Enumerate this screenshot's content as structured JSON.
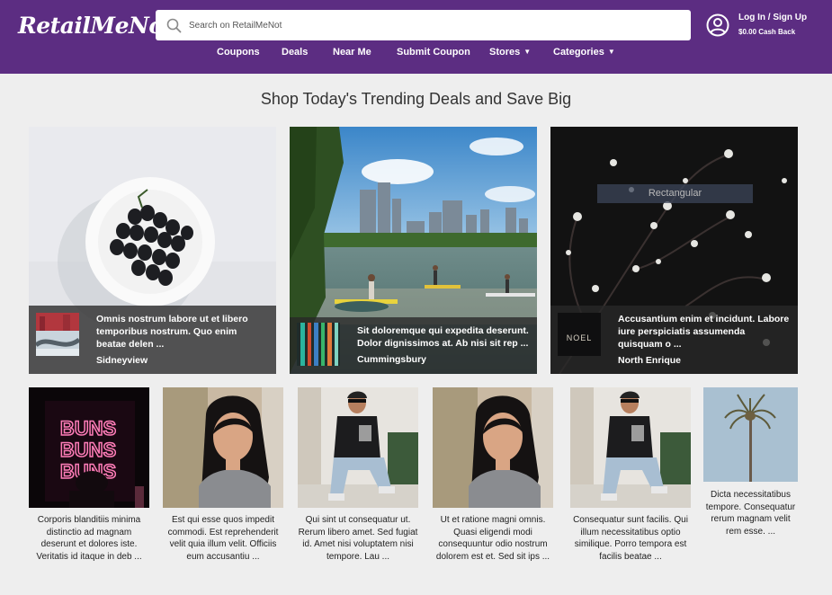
{
  "brand": {
    "logo_text": "RetailMeNot",
    "purple": "#5c2d82"
  },
  "search": {
    "placeholder": "Search on RetailMeNot",
    "value": ""
  },
  "account": {
    "login_label": "Log In / Sign Up",
    "cash_label": "$0.00 Cash Back"
  },
  "nav": [
    {
      "label": "Coupons"
    },
    {
      "label": "Deals"
    },
    {
      "label": "Near Me"
    },
    {
      "label": "Submit Coupon"
    },
    {
      "label": "Stores",
      "has_dropdown": true
    },
    {
      "label": "Categories",
      "has_dropdown": true
    }
  ],
  "page_title": "Shop Today's Trending Deals and Save Big",
  "featured": [
    {
      "title": "Omnis nostrum labore ut et libero temporibus nostrum. Quo enim beatae delen ...",
      "location": "Sidneyview",
      "image": "grapes-on-plate"
    },
    {
      "title": "Sit doloremque qui expedita deserunt. Dolor dignissimos at. Ab nisi sit rep ...",
      "location": "Cummingsbury",
      "image": "city-lake-paddleboard"
    },
    {
      "title": "Accusantium enim et incidunt. Labore iure perspiciatis assumenda quisquam o ...",
      "location": "North Enrique",
      "image": "white-blossoms-dark",
      "overlay_label": "Rectangular"
    }
  ],
  "thumb_labels": {
    "noel": "NOEL"
  },
  "neon_sign": [
    "BUNS",
    "BUNS",
    "BUNS"
  ],
  "cards": [
    {
      "text": "Corporis blanditiis minima distinctio ad magnam deserunt et dolores iste. Veritatis id itaque in deb ...",
      "image": "neon-buns-sign"
    },
    {
      "text": "Est qui esse quos impedit commodi. Est reprehenderit velit quia illum velit. Officiis eum accusantiu ...",
      "image": "smiling-woman"
    },
    {
      "text": "Qui sint ut consequatur ut. Rerum libero amet. Sed fugiat id. Amet nisi voluptatem nisi tempore. Lau ...",
      "image": "man-sitting-sunglasses"
    },
    {
      "text": "Ut et ratione magni omnis. Quasi eligendi modi consequuntur odio nostrum dolorem est et. Sed sit ips ...",
      "image": "smiling-woman"
    },
    {
      "text": "Consequatur sunt facilis. Qui illum necessitatibus optio similique. Porro tempora est facilis beatae ...",
      "image": "man-sitting-sunglasses"
    },
    {
      "text": "Dicta necessitatibus tempore. Consequatur rerum magnam velit rem esse. ...",
      "image": "palm-tree"
    }
  ]
}
